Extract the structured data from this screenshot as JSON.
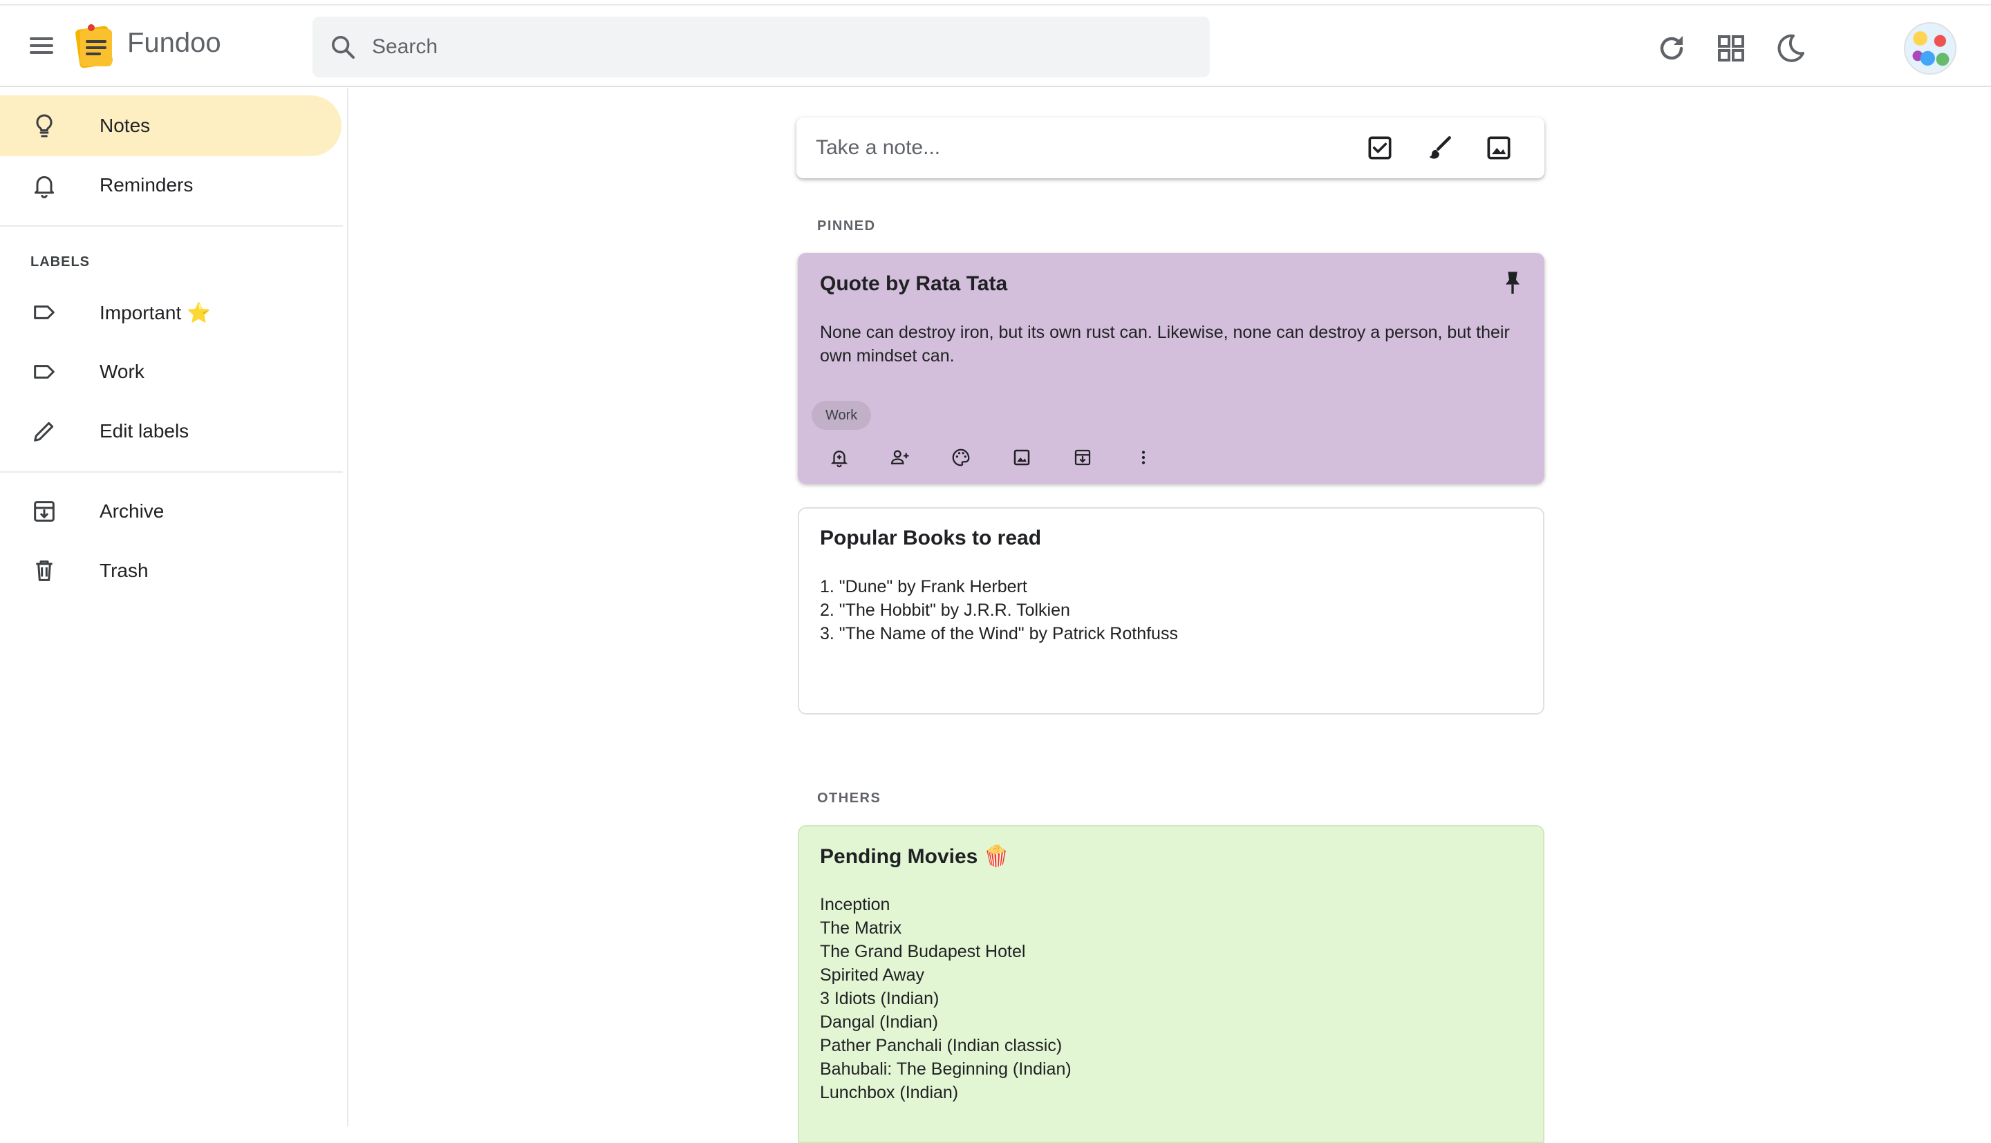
{
  "app": {
    "brand": "Fundoo"
  },
  "search": {
    "placeholder": "Search"
  },
  "header": {
    "icons": [
      "refresh-icon",
      "grid-view-icon",
      "dark-mode-icon"
    ]
  },
  "sidebar": {
    "items": [
      {
        "label": "Notes",
        "icon": "lightbulb-icon",
        "active": true
      },
      {
        "label": "Reminders",
        "icon": "bell-icon"
      }
    ],
    "labels_heading": "LABELS",
    "labels": [
      {
        "label": "Important ⭐",
        "icon": "label-icon"
      },
      {
        "label": "Work",
        "icon": "label-icon"
      },
      {
        "label": "Edit labels",
        "icon": "pencil-icon"
      }
    ],
    "bottom": [
      {
        "label": "Archive",
        "icon": "archive-icon"
      },
      {
        "label": "Trash",
        "icon": "trash-icon"
      }
    ]
  },
  "composer": {
    "placeholder": "Take a note...",
    "icons": [
      "checkbox-icon",
      "brush-icon",
      "image-icon"
    ]
  },
  "sections": {
    "pinned": "PINNED",
    "others": "OTHERS"
  },
  "notes": {
    "pinned": [
      {
        "title": "Quote by Rata Tata",
        "body": "None can destroy iron, but its own rust can. Likewise, none can destroy a person, but their own mindset can.",
        "label": "Work",
        "color": "#d3bfdb",
        "pinned": true
      },
      {
        "title": "Popular Books to read",
        "body": "1. \"Dune\" by Frank Herbert\n2. \"The Hobbit\" by J.R.R. Tolkien\n3. \"The Name of the Wind\" by Patrick Rothfuss",
        "color": "#ffffff"
      }
    ],
    "others": [
      {
        "title": "Pending Movies 🍿",
        "body": "Inception\nThe Matrix\nThe Grand Budapest Hotel\nSpirited Away\n3 Idiots (Indian)\nDangal (Indian)\nPather Panchali (Indian classic)\nBahubali: The Beginning (Indian)\nLunchbox (Indian)",
        "color": "#e2f6d3"
      }
    ]
  }
}
